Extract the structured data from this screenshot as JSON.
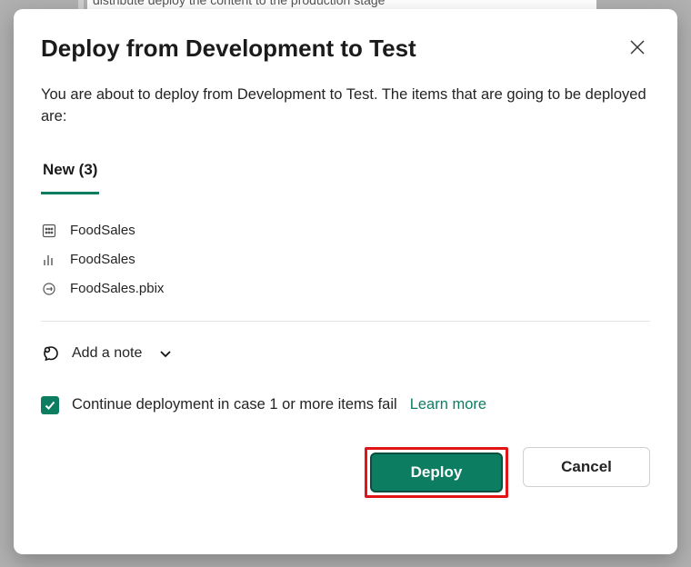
{
  "bg_text": "distribute  deploy the content to the production stage",
  "dialog": {
    "title": "Deploy from Development to Test",
    "description": "You are about to deploy from Development to Test. The items that are going to be deployed are:",
    "tab_label": "New (3)",
    "items": [
      {
        "icon": "dataset-icon",
        "name": "FoodSales"
      },
      {
        "icon": "report-icon",
        "name": "FoodSales"
      },
      {
        "icon": "model-icon",
        "name": "FoodSales.pbix"
      }
    ],
    "add_note_label": "Add a note",
    "continue_label": "Continue deployment in case 1 or more items fail",
    "learn_more_label": "Learn more",
    "deploy_label": "Deploy",
    "cancel_label": "Cancel"
  },
  "colors": {
    "accent": "#0d7d62",
    "highlight": "#e11515"
  }
}
